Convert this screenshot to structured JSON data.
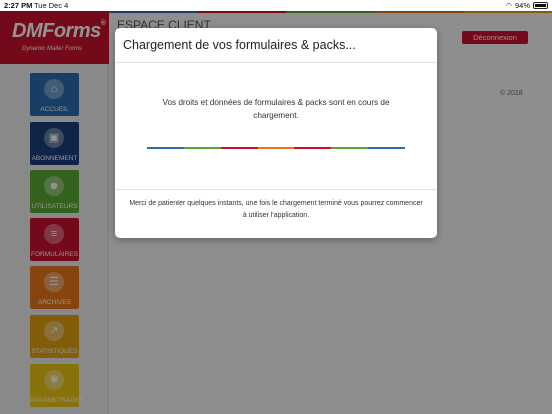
{
  "status_bar": {
    "time": "2:27 PM",
    "date": "Tue Dec 4",
    "battery": "94%"
  },
  "brand": {
    "name": "DMForms",
    "reg": "®",
    "tagline": "Dynamic Mailer Forms"
  },
  "header": {
    "title": "ESPACE CLIENT",
    "logout_label": "Déconnexion"
  },
  "footer": {
    "copyright": "© 2018"
  },
  "sidebar": {
    "items": [
      {
        "label": "ACCUEIL",
        "icon": "home-icon",
        "color": "#2a6bb0"
      },
      {
        "label": "ABONNEMENT",
        "icon": "store-icon",
        "color": "#1b3f7a"
      },
      {
        "label": "UTILISATEURS",
        "icon": "users-icon",
        "color": "#5aa832"
      },
      {
        "label": "FORMULAIRES",
        "icon": "forms-icon",
        "color": "#c8102e"
      },
      {
        "label": "ARCHIVES",
        "icon": "archive-icon",
        "color": "#e8761a"
      },
      {
        "label": "STATISTIQUES",
        "icon": "chart-icon",
        "color": "#e2a012"
      },
      {
        "label": "PARAMETRAGES",
        "icon": "gear-icon",
        "color": "#e8c416"
      }
    ]
  },
  "dialog": {
    "title": "Chargement de vos formulaires & packs...",
    "message": "Vos droits et données de formulaires & packs sont en cours de chargement.",
    "footer": "Merci de patienter quelques instants, une fois le chargement terminé vous pourrez commencer à utiliser l'application.",
    "progress_colors": [
      "#2a6bb0",
      "#5aa832",
      "#c8102e",
      "#e8761a",
      "#c8102e",
      "#5aa832",
      "#2a6bb0"
    ]
  }
}
